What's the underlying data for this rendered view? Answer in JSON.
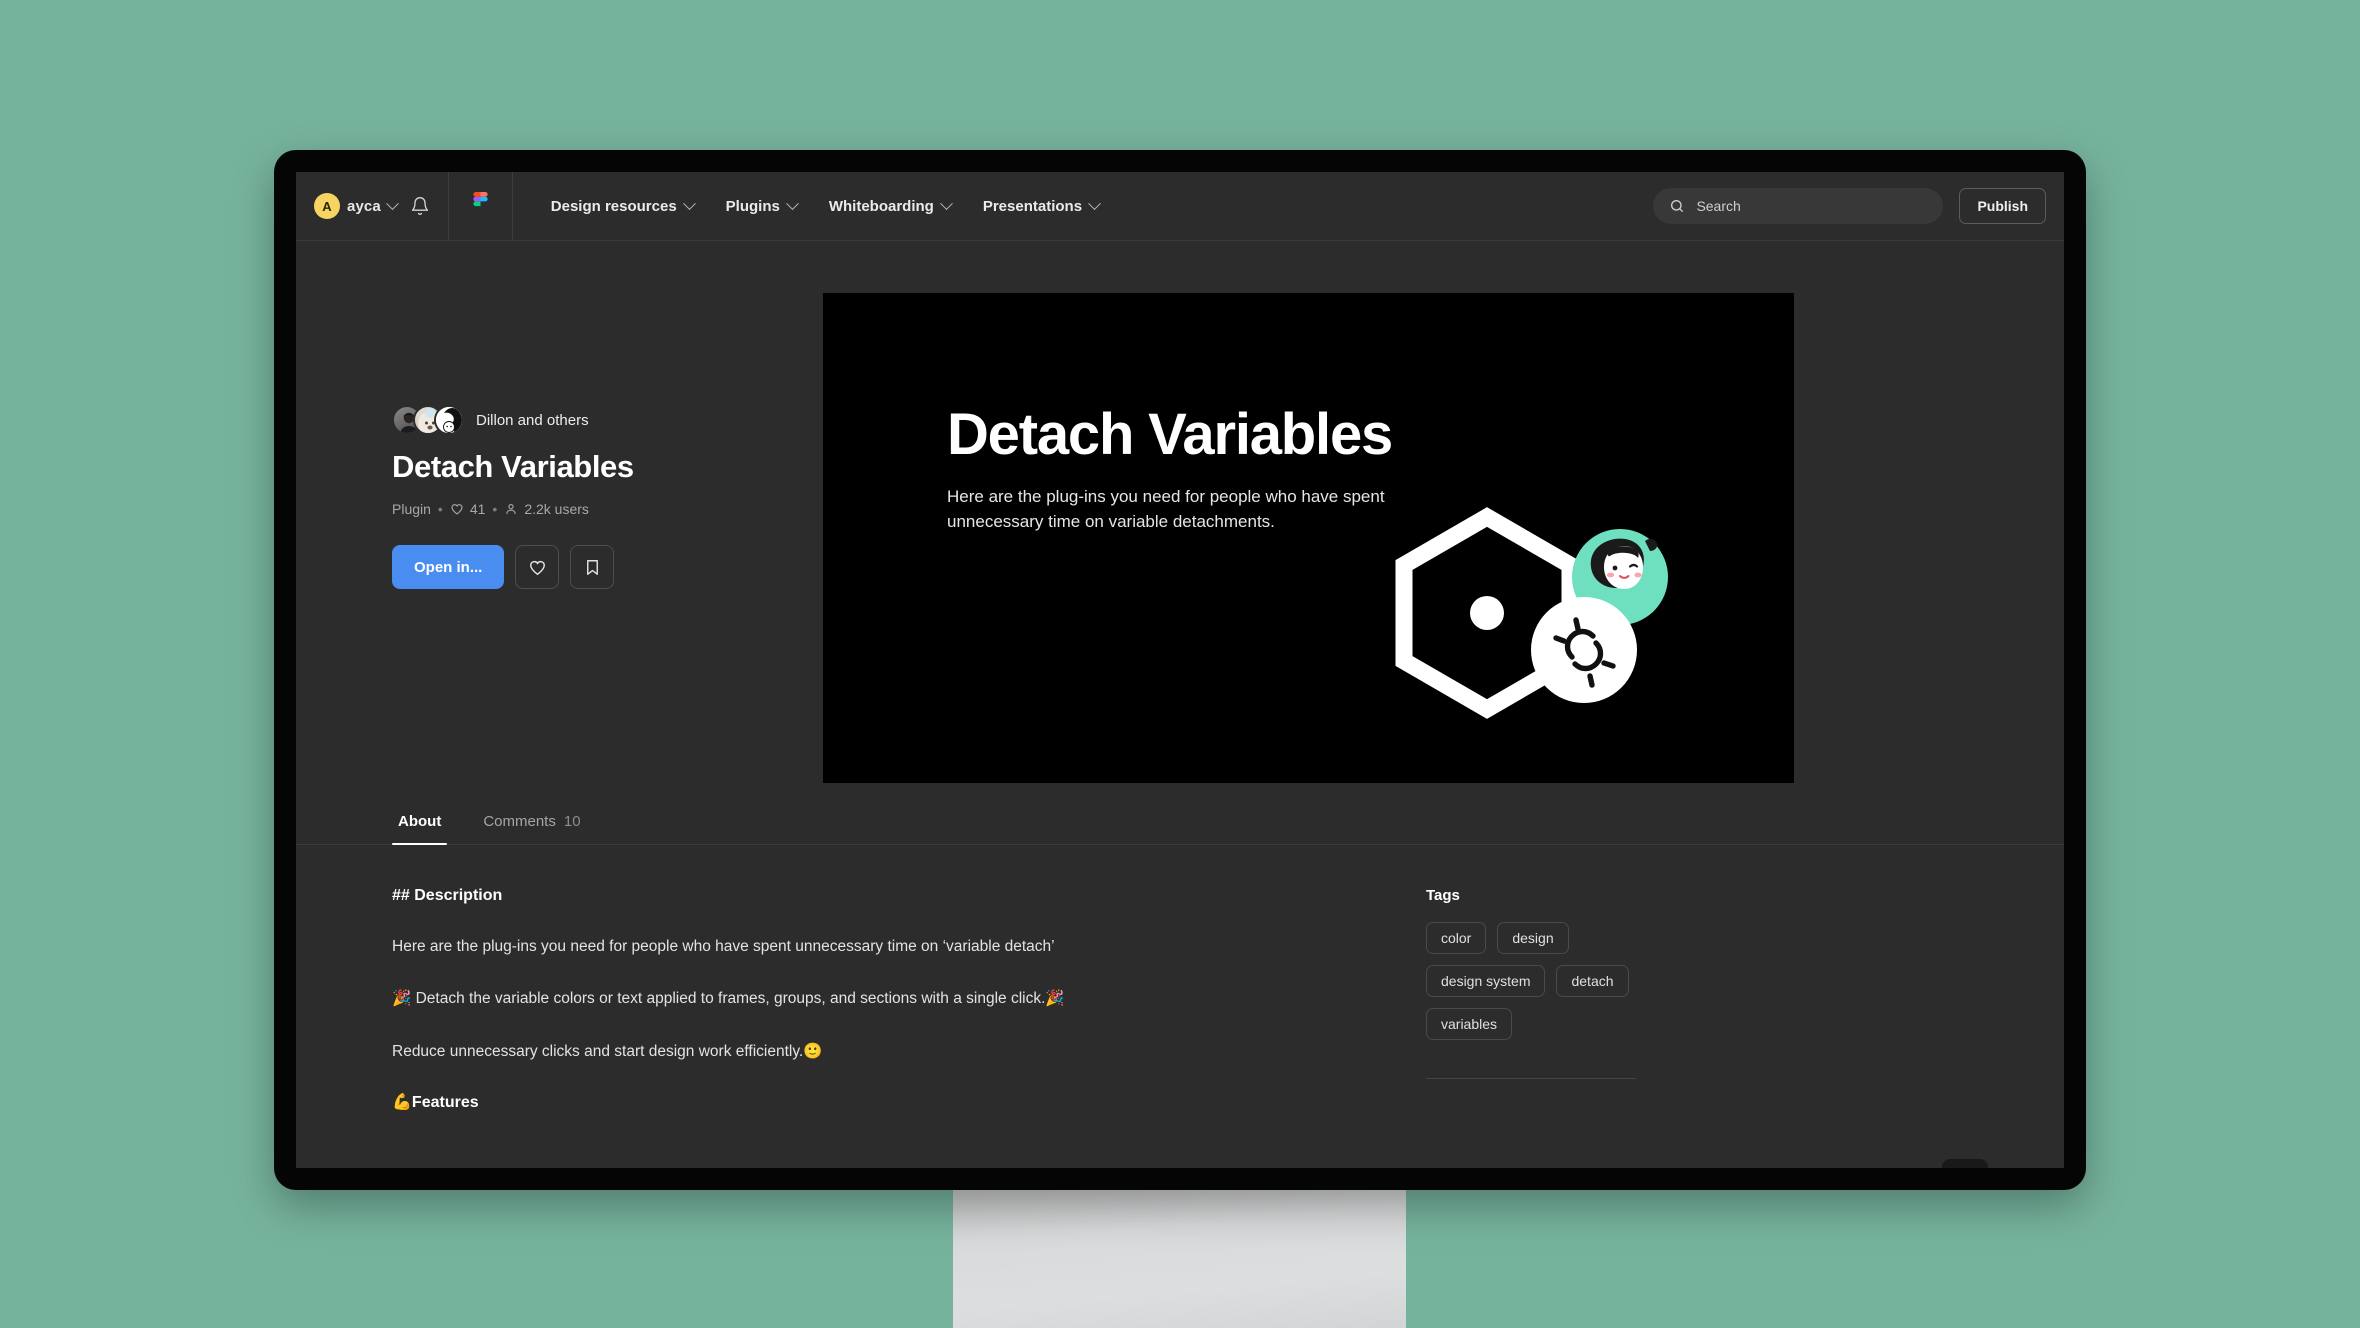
{
  "topbar": {
    "user": {
      "initial": "A",
      "name": "ayca",
      "chevron_icon": "chevron-down-icon"
    },
    "notifications_icon": "bell-icon",
    "brand_icon": "figma-logo-icon",
    "menus": [
      {
        "label": "Design resources",
        "icon": "chevron-down-icon"
      },
      {
        "label": "Plugins",
        "icon": "chevron-down-icon"
      },
      {
        "label": "Whiteboarding",
        "icon": "chevron-down-icon"
      },
      {
        "label": "Presentations",
        "icon": "chevron-down-icon"
      }
    ],
    "search": {
      "placeholder": "Search",
      "value": "",
      "icon": "search-icon"
    },
    "publish_label": "Publish"
  },
  "hero": {
    "author_label": "Dillon and others",
    "title": "Detach Variables",
    "meta": {
      "type": "Plugin",
      "separator": "•",
      "likes": "41",
      "likes_icon": "heart-icon",
      "users": "2.2k users",
      "users_icon": "person-icon"
    },
    "actions": {
      "primary_label": "Open in...",
      "like_icon": "heart-icon",
      "save_icon": "bookmark-icon"
    }
  },
  "cover": {
    "title": "Detach Variables",
    "subtitle": "Here are the plug-ins you need for people who have spent unnecessary time on variable detachments.",
    "graphic": {
      "hexagon_icon": "hexagon-outline-icon",
      "broken_link_icon": "broken-link-icon",
      "avatar_icon": "character-avatar-icon",
      "accent_color": "#6ee0c0"
    }
  },
  "tabs": [
    {
      "label": "About",
      "count": "",
      "active": true
    },
    {
      "label": "Comments",
      "count": "10",
      "active": false
    }
  ],
  "about": {
    "heading": "## Description",
    "paragraphs": [
      "Here are the plug-ins you need for people who have spent unnecessary time on ‘variable detach’",
      "🎉 Detach the variable colors or text applied to frames, groups, and sections with a single click.🎉",
      "Reduce unnecessary clicks and start design work efficiently.🙂"
    ],
    "features_heading": "💪Features"
  },
  "tags": {
    "title": "Tags",
    "items": [
      "color",
      "design",
      "design system",
      "detach",
      "variables"
    ]
  },
  "theme": {
    "page_background": "#76b39d",
    "app_background": "#2c2c2c",
    "cover_background": "#000000",
    "primary_button": "#4a8df0",
    "avatar_chip": "#f5d462"
  }
}
